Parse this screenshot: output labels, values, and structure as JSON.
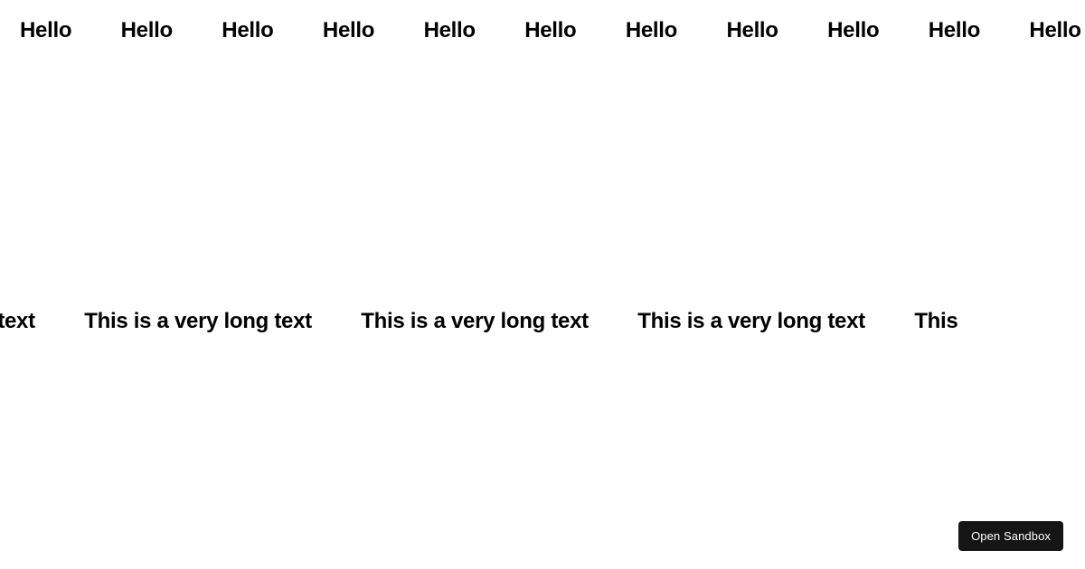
{
  "marquee1": {
    "text": "Hello",
    "repeat_count": 11
  },
  "marquee2": {
    "text": "This is a very long text",
    "partial_start": "ery long text",
    "partial_end": "This",
    "repeat_count": 3
  },
  "button": {
    "open_sandbox_label": "Open Sandbox"
  }
}
